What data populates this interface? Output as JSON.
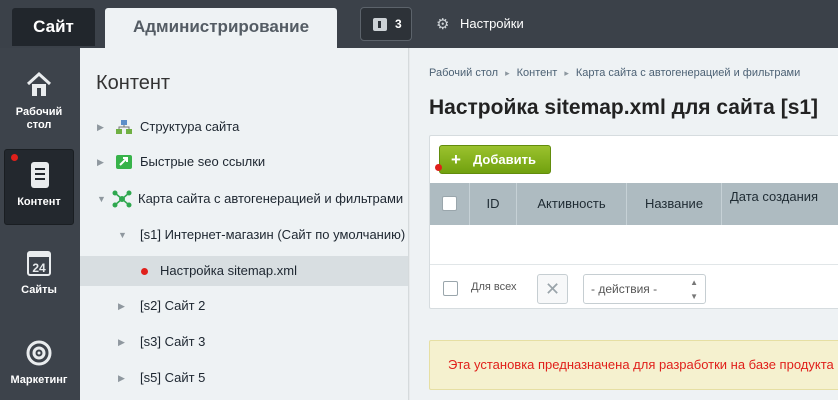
{
  "topbar": {
    "tab_site": "Сайт",
    "tab_admin": "Администрирование",
    "notifications_count": "3",
    "settings_label": "Настройки"
  },
  "left_panel": {
    "items": [
      {
        "label": "Рабочий стол",
        "icon": "home-icon"
      },
      {
        "label": "Контент",
        "icon": "document-icon",
        "active": true,
        "has_dot": true
      },
      {
        "label": "Сайты",
        "icon": "calendar-icon",
        "number": "24"
      },
      {
        "label": "Маркетинг",
        "icon": "target-icon"
      }
    ]
  },
  "tree": {
    "title": "Контент",
    "rows": [
      {
        "label": "Структура сайта",
        "icon": "structure-icon"
      },
      {
        "label": "Быстрые seo ссылки",
        "icon": "seo-link-icon"
      },
      {
        "label": "Карта сайта с автогенерацией и фильтрами",
        "icon": "sitemap-icon"
      },
      {
        "label": "[s1] Интернет-магазин (Сайт по умолчанию)"
      },
      {
        "label": "Настройка sitemap.xml",
        "selected": true
      },
      {
        "label": "[s2] Сайт 2"
      },
      {
        "label": "[s3] Сайт 3"
      },
      {
        "label": "[s5] Сайт 5"
      }
    ]
  },
  "main": {
    "breadcrumbs": [
      "Рабочий стол",
      "Контент",
      "Карта сайта с автогенерацией и фильтрами"
    ],
    "title": "Настройка sitemap.xml для сайта [s1]",
    "add_button": "Добавить",
    "columns": [
      "ID",
      "Активность",
      "Название",
      "Дата создания"
    ],
    "footer": {
      "for_all": "Для всех",
      "actions_select": "- действия -"
    },
    "warning": "Эта установка предназначена для разработки на базе продукта"
  },
  "colors": {
    "accent_green": "#7aab14",
    "warning_text": "#e0201b",
    "topbar": "#3b4149"
  }
}
